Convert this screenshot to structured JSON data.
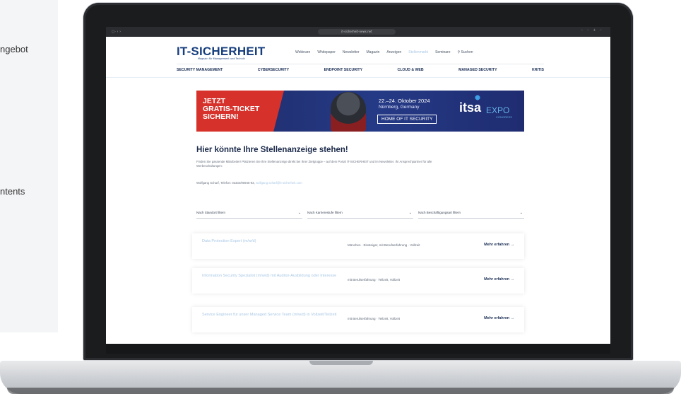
{
  "background": {
    "fragments": [
      "ngebot",
      "ntents"
    ]
  },
  "browser": {
    "tab_controls": "○· ‹ ›",
    "url": "it-sicherheit-news.net",
    "right_controls": "◦ ◦ + ◦"
  },
  "site": {
    "logo": "IT-SICHERHEIT",
    "logo_sub": "Magazin für Management und Technik",
    "top_nav": [
      "Webinare",
      "Whitepaper",
      "Newsletter",
      "Magazin",
      "Anzeigen",
      "Stellenmarkt",
      "Seminare",
      "Suchen"
    ],
    "top_nav_active": "Stellenmarkt",
    "main_nav": [
      "SECURITY MANAGEMENT",
      "CYBERSECURITY",
      "ENDPOINT SECURITY",
      "CLOUD & WEB",
      "MANAGED SECURITY",
      "KRITIS"
    ]
  },
  "banner": {
    "cta_line1": "JETZT",
    "cta_line2": "GRATIS-TICKET",
    "cta_line3": "SICHERN!",
    "date": "22.–24. Oktober 2024",
    "city": "Nürnberg, Germany",
    "home": "HOME OF IT SECURITY",
    "brand": "itsa",
    "brand_expo": "EXPO",
    "brand_congress": "CONGRESS"
  },
  "content": {
    "heading": "Hier könnte Ihre Stellenanzeige stehen!",
    "intro": "Finden Sie passende Mitarbeiter! Platzieren Sie Ihre Stellenanzeige direkt bei Ihrer Zielgruppe – auf dem Portal IT-SICHERHEIT und im Newsletter. Ihr Ansprechpartner für alle Werbeschaltungen:",
    "contact_name": "Wolfgang Scharf, Telefon: 02334/90945-93,",
    "contact_mail": "wolfgang.scharf@it-sicherheit.com"
  },
  "filters": [
    {
      "label": "Nach Standort filtern"
    },
    {
      "label": "Nach Karrierestufe filtern"
    },
    {
      "label": "Nach Beschäftigungsart filtern"
    }
  ],
  "jobs": [
    {
      "title": "Data Protection Expert (m/w/d)",
      "meta": "München · Einsteiger, mit Berufserfahrung · Vollzeit",
      "more": "Mehr erfahren"
    },
    {
      "title": "Information Security Spezialist (m/w/d) mit Auditor-Ausbildung oder Interesse",
      "meta": "mit Berufserfahrung · Teilzeit, Vollzeit",
      "more": "Mehr erfahren"
    },
    {
      "title": "Service Engineer für unser Managed Service Team (m/w/d) in Vollzeit/Teilzeit",
      "meta": "mit Berufserfahrung · Teilzeit, Vollzeit",
      "more": "Mehr erfahren"
    }
  ]
}
